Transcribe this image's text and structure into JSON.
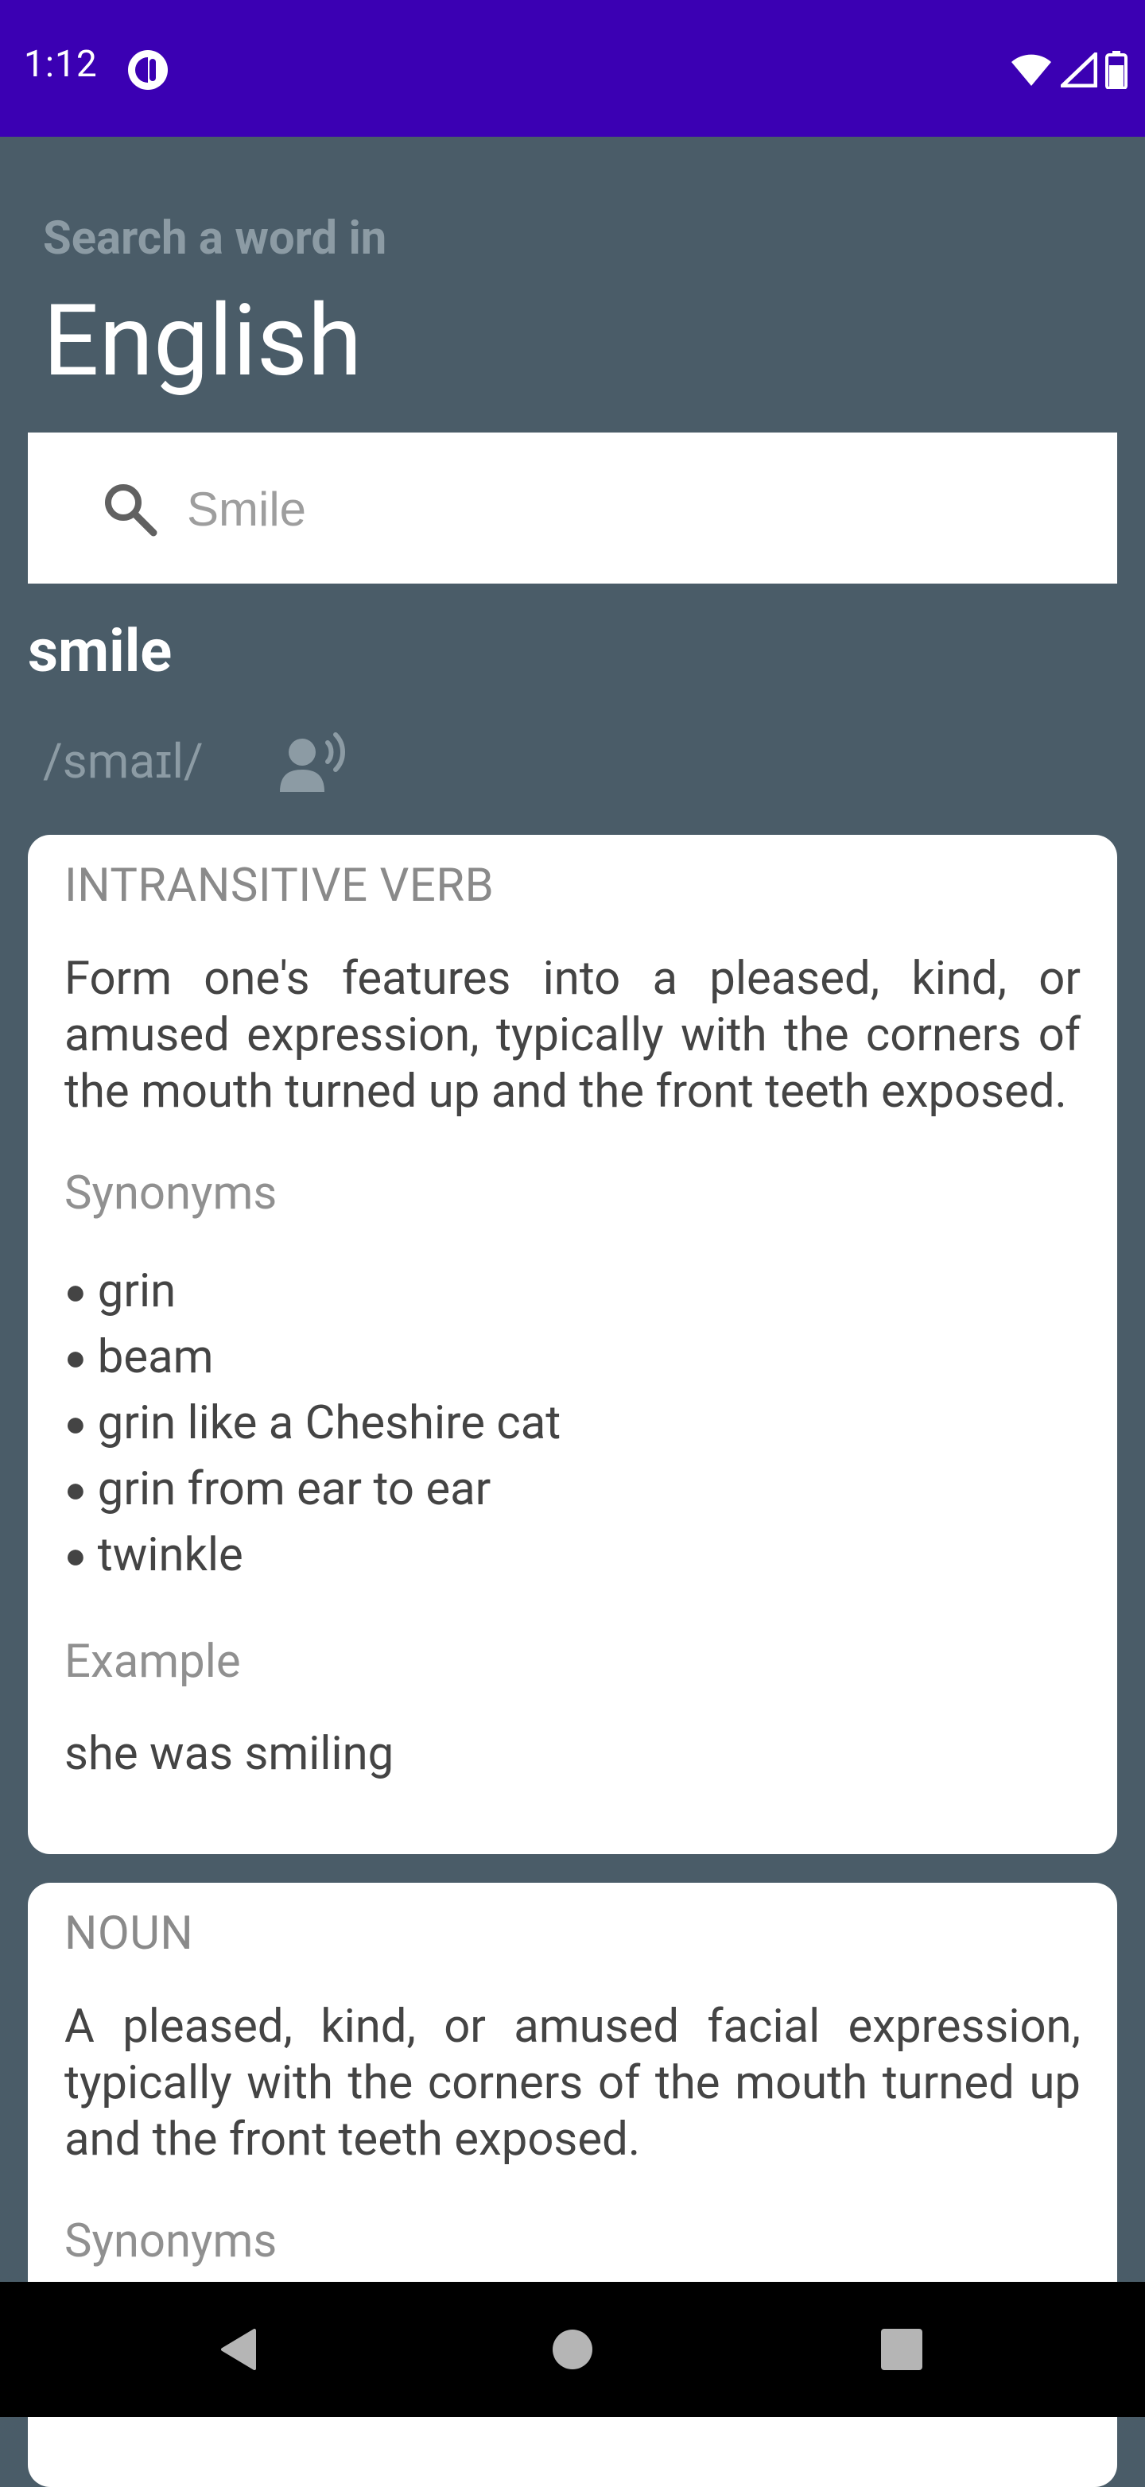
{
  "status_bar": {
    "time": "1:12",
    "icons": [
      "app-notification-icon",
      "wifi-icon",
      "cell-signal-icon",
      "battery-icon"
    ]
  },
  "header": {
    "subtitle": "Search a word in",
    "language": "English"
  },
  "search": {
    "placeholder": "Smile",
    "value": ""
  },
  "entry": {
    "word": "smile",
    "phonetic": "/smaɪl/",
    "meanings": [
      {
        "part_of_speech": "INTRANSITIVE VERB",
        "definition": "Form one's features into a pleased, kind, or amused expression, typically with the corners of the mouth turned up and the front teeth exposed.",
        "synonyms_label": "Synonyms",
        "synonyms": [
          "grin",
          "beam",
          "grin like a Cheshire cat",
          "grin from ear to ear",
          "twinkle"
        ],
        "example_label": "Example",
        "example": "she was smiling"
      },
      {
        "part_of_speech": "NOUN",
        "definition": "A pleased, kind, or amused facial expression, typically with the corners of the mouth turned up and the front teeth exposed.",
        "synonyms_label": "Synonyms"
      }
    ]
  },
  "nav": {
    "buttons": [
      "back-icon",
      "home-icon",
      "recents-icon"
    ]
  },
  "colors": {
    "status_bar": "#3b00b3",
    "background": "#4a5c68",
    "card": "#ffffff",
    "muted_text": "#8c9ba4"
  }
}
